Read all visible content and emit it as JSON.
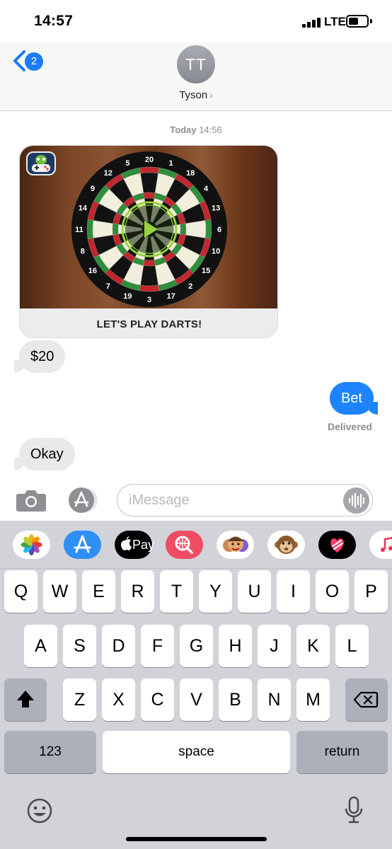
{
  "status": {
    "time": "14:57",
    "network": "LTE",
    "battery_level": 0.55
  },
  "header": {
    "back_count": "2",
    "avatar_initials": "TT",
    "contact_name": "Tyson",
    "contact_chevron": "›"
  },
  "conversation": {
    "timestamp_day": "Today",
    "timestamp_time": "14:56",
    "game_card": {
      "caption": "LET'S PLAY DARTS!",
      "board_numbers": [
        "20",
        "1",
        "18",
        "4",
        "13",
        "6",
        "10",
        "15",
        "2",
        "17",
        "3",
        "19",
        "7",
        "16",
        "8",
        "11",
        "14",
        "9",
        "12",
        "5"
      ]
    },
    "messages": [
      {
        "direction": "incoming",
        "text": "$20"
      },
      {
        "direction": "outgoing",
        "text": "Bet"
      },
      {
        "direction": "incoming",
        "text": "Okay"
      }
    ],
    "delivered_label": "Delivered"
  },
  "input": {
    "placeholder": "iMessage"
  },
  "app_strip": [
    "photos-icon",
    "app-store-icon",
    "apple-pay-icon",
    "image-search-icon",
    "memoji-stickers-icon",
    "animoji-icon",
    "digital-touch-icon",
    "music-icon"
  ],
  "apple_pay_label": "Pay",
  "keyboard": {
    "row1": [
      "Q",
      "W",
      "E",
      "R",
      "T",
      "Y",
      "U",
      "I",
      "O",
      "P"
    ],
    "row2": [
      "A",
      "S",
      "D",
      "F",
      "G",
      "H",
      "J",
      "K",
      "L"
    ],
    "row3": [
      "Z",
      "X",
      "C",
      "V",
      "B",
      "N",
      "M"
    ],
    "numbers_label": "123",
    "space_label": "space",
    "return_label": "return"
  },
  "colors": {
    "accent_blue": "#1b84fe",
    "incoming_bubble": "#e9e9eb",
    "keyboard_bg": "#d1d3d9"
  }
}
